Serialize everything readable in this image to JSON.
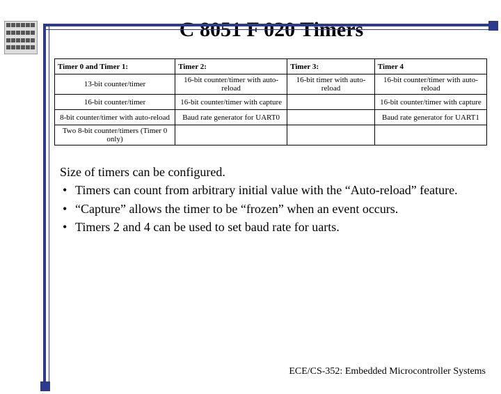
{
  "title": "C 8051 F 020 Timers",
  "table": {
    "headers": [
      "Timer 0 and Timer 1:",
      "Timer 2:",
      "Timer 3:",
      "Timer 4"
    ],
    "rows": [
      [
        "13-bit counter/timer",
        "16-bit counter/timer with auto-reload",
        "16-bit timer with auto-reload",
        "16-bit counter/timer with auto-reload"
      ],
      [
        "16-bit counter/timer",
        "16-bit counter/timer with capture",
        "",
        "16-bit counter/timer with capture"
      ],
      [
        "8-bit counter/timer with auto-reload",
        "Baud rate generator for UART0",
        "",
        "Baud rate generator for UART1"
      ],
      [
        "Two 8-bit counter/timers (Timer 0 only)",
        "",
        "",
        ""
      ]
    ]
  },
  "notes": {
    "intro": "Size of timers can be configured.",
    "bullets": [
      "Timers can count from arbitrary initial value with the “Auto-reload” feature.",
      "“Capture” allows the timer to be “frozen” when an event occurs.",
      "Timers 2 and 4 can be used to set baud rate for uarts."
    ]
  },
  "footer": "ECE/CS-352: Embedded Microcontroller Systems"
}
